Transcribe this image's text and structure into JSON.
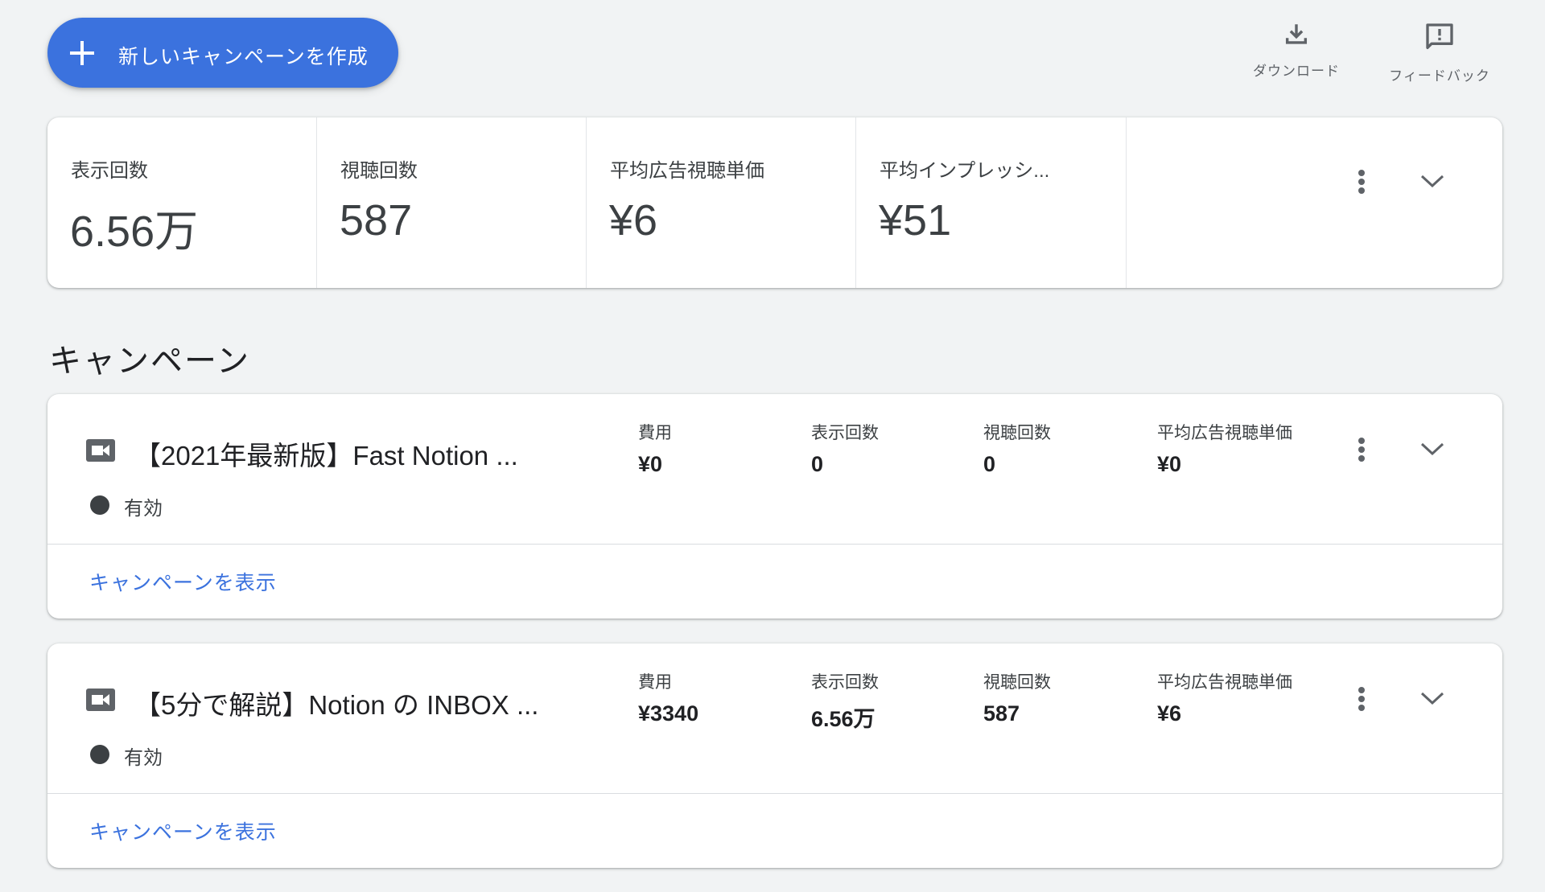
{
  "toolbar": {
    "create_label": "新しいキャンペーンを作成",
    "download_label": "ダウンロード",
    "feedback_label": "フィードバック"
  },
  "summary": {
    "metrics": [
      {
        "label": "表示回数",
        "value": "6.56万"
      },
      {
        "label": "視聴回数",
        "value": "587"
      },
      {
        "label": "平均広告視聴単価",
        "value": "¥6"
      },
      {
        "label": "平均インプレッシ...",
        "value": "¥51"
      }
    ]
  },
  "section": {
    "title": "キャンペーン"
  },
  "campaigns": [
    {
      "name": "【2021年最新版】Fast Notion ...",
      "status": "有効",
      "metrics": [
        {
          "label": "費用",
          "value": "¥0"
        },
        {
          "label": "表示回数",
          "value": "0"
        },
        {
          "label": "視聴回数",
          "value": "0"
        },
        {
          "label": "平均広告視聴単価",
          "value": "¥0"
        }
      ],
      "link": "キャンペーンを表示"
    },
    {
      "name": "【5分で解説】Notion の INBOX ...",
      "status": "有効",
      "metrics": [
        {
          "label": "費用",
          "value": "¥3340"
        },
        {
          "label": "表示回数",
          "value": "6.56万"
        },
        {
          "label": "視聴回数",
          "value": "587"
        },
        {
          "label": "平均広告視聴単価",
          "value": "¥6"
        }
      ],
      "link": "キャンペーンを表示"
    }
  ],
  "colors": {
    "accent": "#3b72de",
    "background": "#f1f3f4",
    "status_active": "#3c4043"
  }
}
